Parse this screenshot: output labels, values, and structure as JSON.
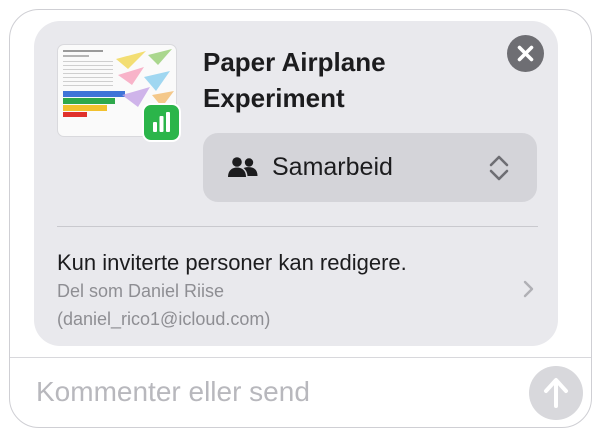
{
  "document": {
    "title": "Paper Airplane Experiment",
    "app_icon": "numbers-icon"
  },
  "collaboration": {
    "selected": "Samarbeid",
    "icon": "people-icon"
  },
  "permissions": {
    "summary": "Kun inviterte personer kan redigere.",
    "shared_as": "Del som Daniel Riise",
    "account": "(daniel_rico1@icloud.com)"
  },
  "comment": {
    "placeholder": "Kommenter eller send"
  },
  "colors": {
    "card_bg": "#e9e9ed",
    "numbers_green": "#2bb54a",
    "close_button": "#6e6e73",
    "send_button": "#d8d8dc"
  }
}
